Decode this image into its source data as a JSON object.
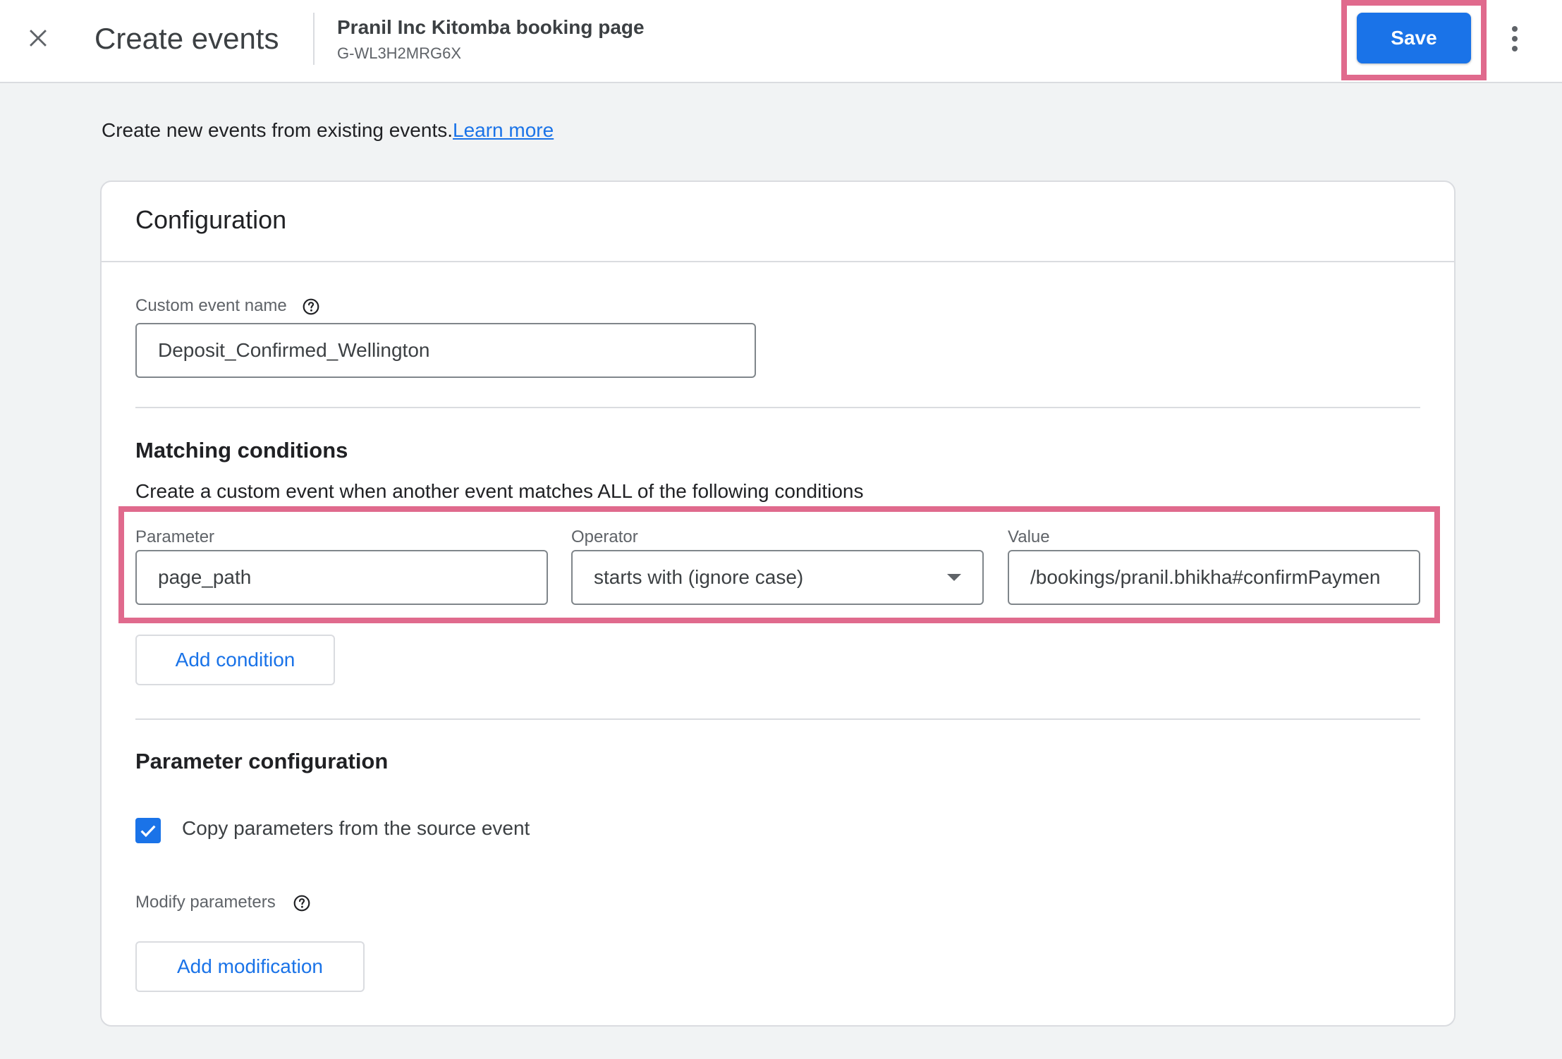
{
  "header": {
    "title": "Create events",
    "property_name": "Pranil Inc Kitomba booking page",
    "property_id": "G-WL3H2MRG6X",
    "save_label": "Save"
  },
  "intro": {
    "text": "Create new events from existing events.",
    "link": "Learn more"
  },
  "configuration": {
    "title": "Configuration",
    "custom_event_name": {
      "label": "Custom event name",
      "value": "Deposit_Confirmed_Wellington"
    },
    "matching": {
      "heading": "Matching conditions",
      "description": "Create a custom event when another event matches ALL of the following conditions",
      "condition": {
        "parameter_label": "Parameter",
        "parameter_value": "page_path",
        "operator_label": "Operator",
        "operator_value": "starts with (ignore case)",
        "value_label": "Value",
        "value_value": "/bookings/pranil.bhikha#confirmPaymen"
      },
      "add_condition_label": "Add condition"
    },
    "parameter_configuration": {
      "heading": "Parameter configuration",
      "copy_label": "Copy parameters from the source event",
      "copy_checked": true,
      "modify_label": "Modify parameters",
      "add_modification_label": "Add modification"
    }
  },
  "colors": {
    "accent": "#1a73e8",
    "highlight": "#e06a8d"
  }
}
